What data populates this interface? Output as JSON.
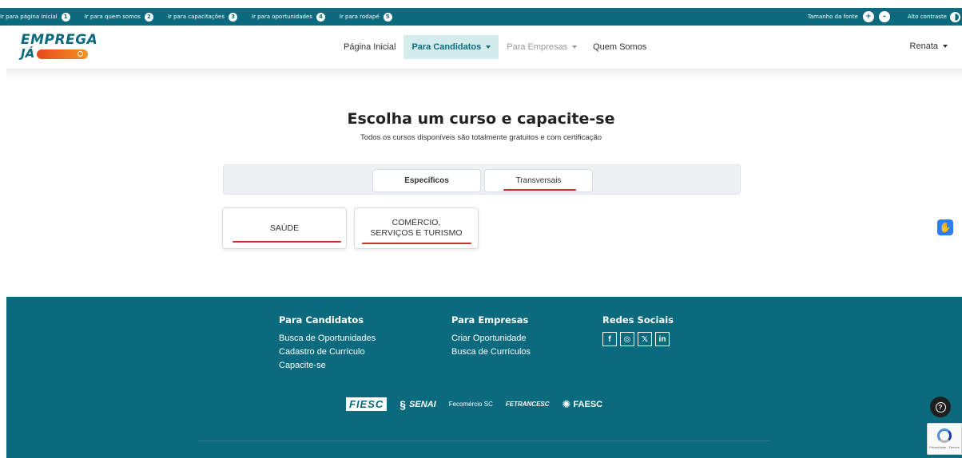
{
  "a11y_bar": {
    "links": [
      {
        "label": "Ir para página inicial",
        "num": "1"
      },
      {
        "label": "Ir para quem somos",
        "num": "2"
      },
      {
        "label": "Ir para capacitações",
        "num": "3"
      },
      {
        "label": "Ir para oportunidades",
        "num": "4"
      },
      {
        "label": "Ir para rodapé",
        "num": "5"
      }
    ],
    "font_size_label": "Tamanho da fonte",
    "font_increase": "+",
    "font_decrease": "-",
    "contrast_label": "Alto contraste"
  },
  "header": {
    "logo_top": "EMPREGA",
    "logo_bottom": "JÁ",
    "nav": [
      {
        "label": "Página Inicial"
      },
      {
        "label": "Para Candidatos"
      },
      {
        "label": "Para Empresas"
      },
      {
        "label": "Quem Somos"
      }
    ],
    "user": "Renata"
  },
  "main": {
    "title": "Escolha um curso e capacite-se",
    "subtitle": "Todos os cursos disponíveis são totalmente gratuitos e com certificação",
    "tabs": [
      {
        "label": "Específicos"
      },
      {
        "label": "Transversais"
      }
    ],
    "categories": [
      {
        "label": "SAÚDE"
      },
      {
        "line1": "COMÉRCIO,",
        "line2": "SERVIÇOS E TURISMO"
      }
    ]
  },
  "footer": {
    "candidatos": {
      "title": "Para Candidatos",
      "links": [
        "Busca de Oportunidades",
        "Cadastro de Currículo",
        "Capacite-se"
      ]
    },
    "empresas": {
      "title": "Para Empresas",
      "links": [
        "Criar Oportunidade",
        "Busca de Currículos"
      ]
    },
    "social": {
      "title": "Redes Sociais",
      "icons": [
        "f",
        "◎",
        "𝕏",
        "in"
      ]
    },
    "logos": {
      "fiesc": "FIESC",
      "senai": "SENAI",
      "fecomercio": "Fecomércio SC",
      "fetrancesc": "FETRANCESC",
      "faesc": "FAESC"
    }
  },
  "colors": {
    "primary": "#0b6a7d",
    "nav_active_bg": "#d5ecec",
    "underline_red": "#d0302f",
    "logo_orange": "#e8491e"
  }
}
